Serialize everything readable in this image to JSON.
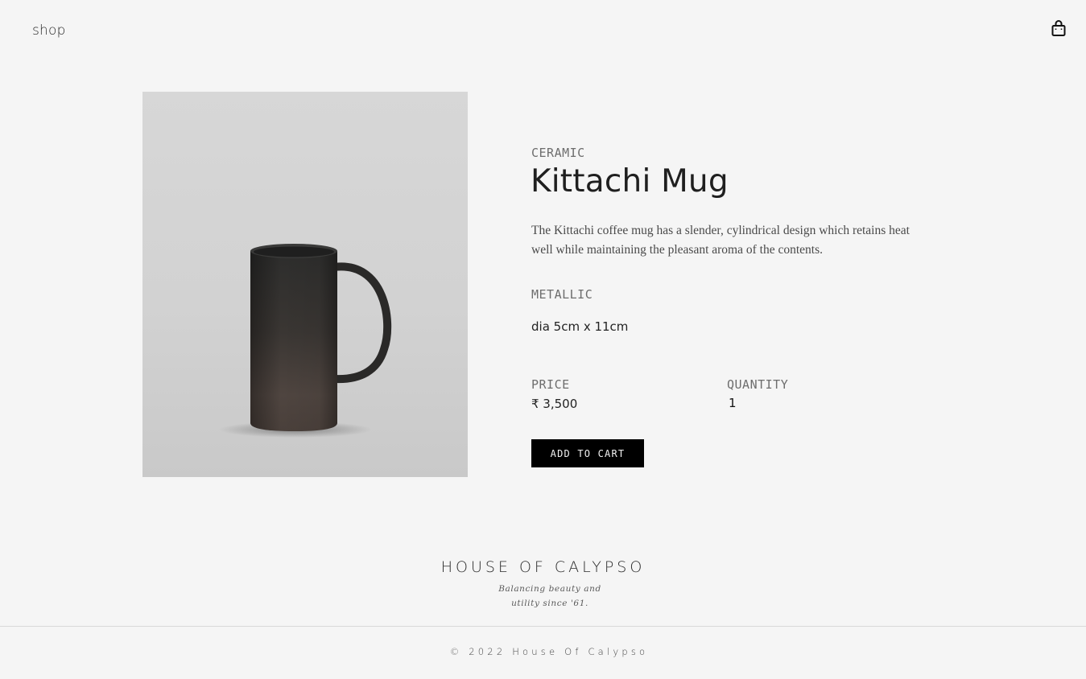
{
  "header": {
    "nav_shop_label": "shop",
    "cart_icon": "shopping-bag-icon"
  },
  "product": {
    "image_subject": "mug-photo",
    "category": "CERAMIC",
    "title": "Kittachi Mug",
    "description": "The Kittachi coffee mug has a slender, cylindrical design which retains heat well while maintaining the pleasant aroma of the contents.",
    "finish": "METALLIC",
    "dimensions": "dia 5cm x 11cm",
    "price_label": "PRICE",
    "price_value": "₹ 3,500",
    "quantity_label": "QUANTITY",
    "quantity_value": "1",
    "add_to_cart_label": "ADD TO CART"
  },
  "footer": {
    "brand": "HOUSE OF CALYPSO",
    "tagline_line1": "Balancing beauty and",
    "tagline_line2": "utility since '61.",
    "copyright": "© 2022 House Of Calypso"
  },
  "colors": {
    "background": "#f5f5f5",
    "button_bg": "#000000",
    "button_text": "#f2f2f2",
    "muted_label": "#6d6d6d"
  }
}
